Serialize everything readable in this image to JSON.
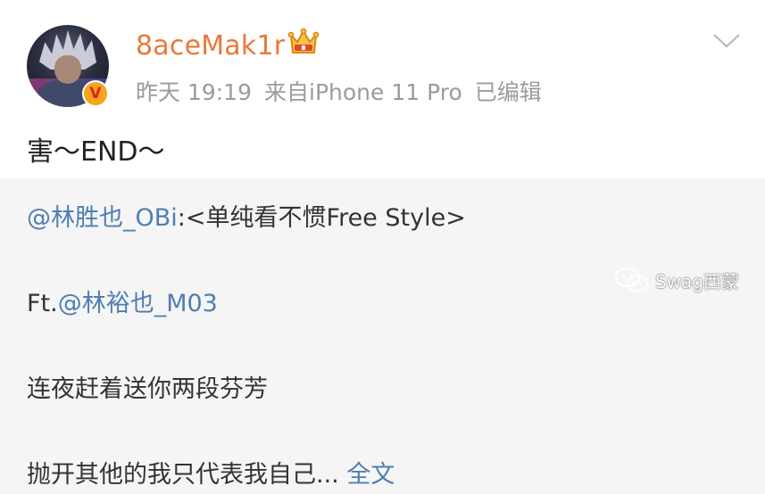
{
  "post": {
    "username": "8aceMak1r",
    "verified_badge": "V",
    "time": "昨天 19:19",
    "source": "来自iPhone 11 Pro",
    "edited": "已编辑",
    "text": "害～END～",
    "icons": {
      "vip": "crown-icon",
      "menu": "chevron-down-icon"
    }
  },
  "repost": {
    "line1_mention": "@林胜也_OBi",
    "line1_text": ":<单纯看不惯Free Style>",
    "line2_prefix": "Ft.",
    "line2_mention": "@林裕也_M03",
    "line3": "连夜赶着送你两段芬芳",
    "line4_text": "抛开其他的我只代表我自己...",
    "line4_more": "全文"
  },
  "watermark": {
    "text": "Swag西蒙",
    "icon": "wechat-icon"
  },
  "colors": {
    "username": "#e9783a",
    "link": "#4f7db3",
    "meta": "#9b9b9b",
    "repost_bg": "#f5f5f5",
    "badge": "#f7a51c"
  }
}
